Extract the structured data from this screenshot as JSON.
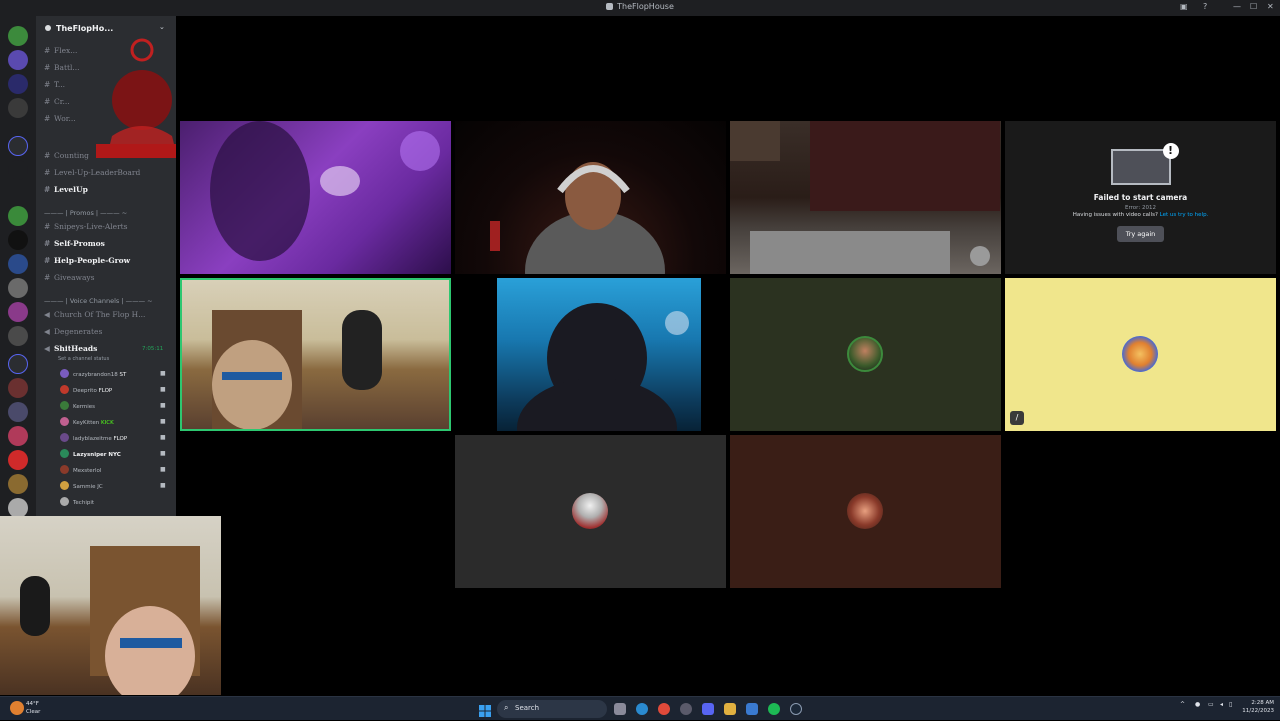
{
  "window": {
    "title": "TheFlopHouse"
  },
  "server": {
    "name": "TheFlopHo..."
  },
  "channels": [
    {
      "name": "Flex...",
      "bold": false
    },
    {
      "name": "Battl...",
      "bold": false
    },
    {
      "name": "T...",
      "bold": false
    },
    {
      "name": "Cr...",
      "bold": false
    },
    {
      "name": "Wor...",
      "bold": false
    },
    {
      "name": "Counting",
      "bold": false
    },
    {
      "name": "Level-Up-LeaderBoard",
      "bold": false
    },
    {
      "name": "LevelUp",
      "bold": true
    },
    {
      "name": "Snipeys-Live-Alerts",
      "bold": false
    },
    {
      "name": "Self-Promos",
      "bold": true
    },
    {
      "name": "Help-People-Grow",
      "bold": true
    },
    {
      "name": "Giveaways",
      "bold": false
    }
  ],
  "categories": {
    "promos": "——— | Promos | ——— ~",
    "voice": "——— | Voice Channels | ——— ~"
  },
  "voice_channels": [
    {
      "name": "Church Of The Flop H..."
    },
    {
      "name": "Degenerates"
    },
    {
      "name": "ShitHeads",
      "timer": "7:05:11",
      "status": "Set a channel status"
    }
  ],
  "voice_users": [
    {
      "name": "crazybrandon18",
      "tag": "ST",
      "color": "#7a5cc0"
    },
    {
      "name": "Deeprito",
      "tag": "FLOP",
      "color": "#c0392b"
    },
    {
      "name": "Kermies",
      "tag": "",
      "color": "#3a7a3a"
    },
    {
      "name": "KeyKitten",
      "tag": "KICK",
      "color": "#c06090"
    },
    {
      "name": "ladyblazeitme",
      "tag": "FLOP",
      "color": "#6a4a8a"
    },
    {
      "name": "Lazysniper",
      "tag": "NYC",
      "color": "#2a8a5a"
    },
    {
      "name": "Mexsterlol",
      "tag": "",
      "color": "#8a3a2a"
    },
    {
      "name": "Sammie JC",
      "tag": "",
      "color": "#d0a040"
    },
    {
      "name": "Techipit",
      "tag": "",
      "color": "#aaaaaa"
    }
  ],
  "camera_error": {
    "heading": "Failed to start camera",
    "error": "Error: 2012",
    "help_text": "Having issues with video calls?",
    "help_link": "Let us try to help.",
    "button": "Try again"
  },
  "taskbar": {
    "weather_temp": "44°F",
    "weather_desc": "Clear",
    "search_placeholder": "Search",
    "time": "2:28 AM",
    "date": "11/22/2023"
  },
  "colors": {
    "speaking_border": "#2dc770",
    "discord_bg": "#2b2d31",
    "taskbar_bg": "#1c2431"
  }
}
